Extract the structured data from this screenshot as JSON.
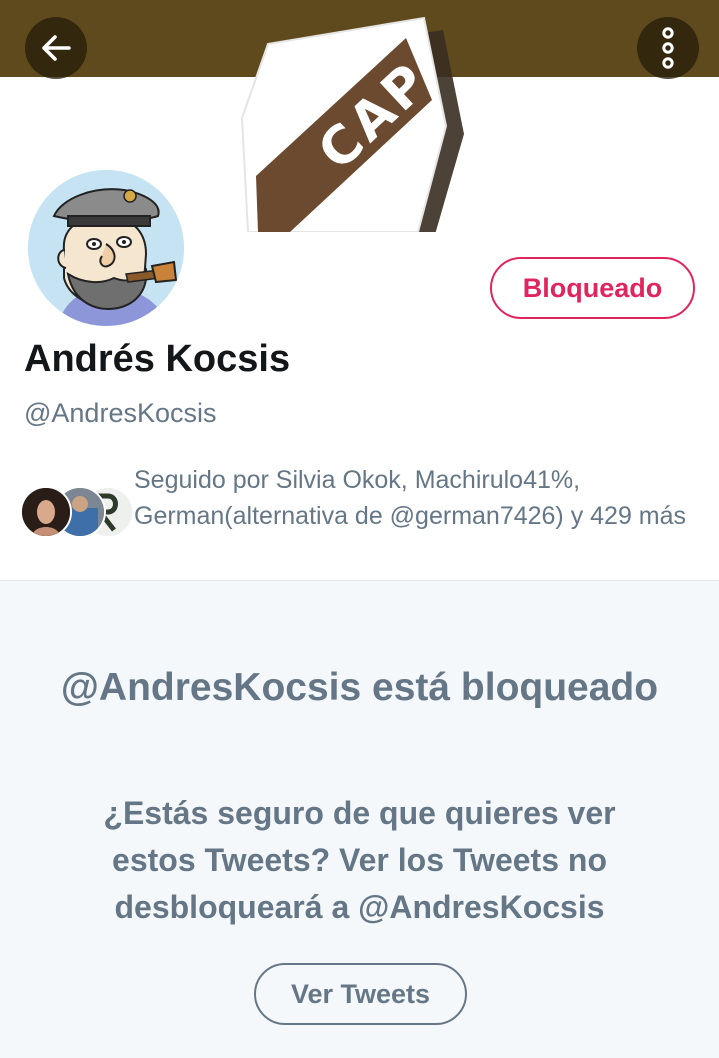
{
  "header": {
    "back_icon": "arrow-left-icon",
    "more_icon": "more-vertical-icon",
    "banner_logo_text": "CAP"
  },
  "profile": {
    "display_name": "Andrés Kocsis",
    "handle": "@AndresKocsis",
    "blocked_button_label": "Bloqueado",
    "followed_by": "Seguido por Silvia Okok, Machirulo41%, German(alternativa de @german7426) y 429 más"
  },
  "blocked_notice": {
    "title": "@AndresKocsis está bloqueado",
    "message": "¿Estás seguro de que quieres ver estos Tweets? Ver los Tweets no desbloqueará a @AndresKocsis",
    "view_button_label": "Ver Tweets"
  },
  "colors": {
    "accent_red": "#e0245e",
    "secondary_text": "#657786",
    "primary_text": "#14171a",
    "banner_brown": "#5e4a1d"
  }
}
